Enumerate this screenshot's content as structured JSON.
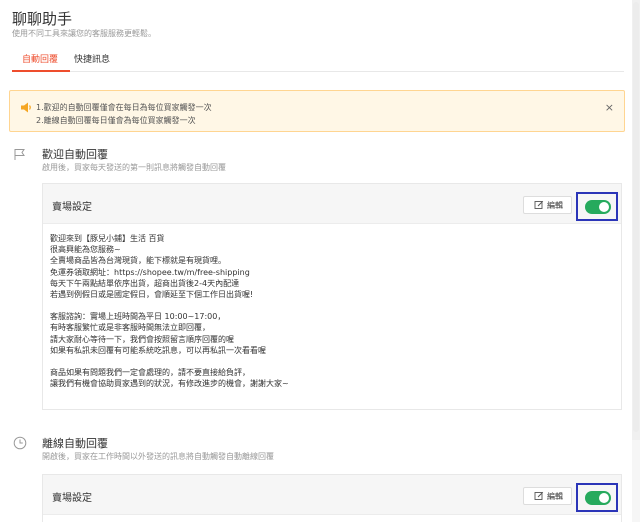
{
  "header": {
    "title": "聊聊助手",
    "subtitle": "使用不同工具來讓您的客服服務更輕鬆。"
  },
  "tabs": [
    {
      "label": "自動回覆",
      "active": true
    },
    {
      "label": "快捷訊息",
      "active": false
    }
  ],
  "notice": {
    "lines": [
      "1.歡迎的自動回覆僅會在每日為每位買家觸發一次",
      "2.離線自動回覆每日僅會為每位買家觸發一次"
    ],
    "close_icon": "×"
  },
  "welcome": {
    "title": "歡迎自動回覆",
    "description": "啟用後，買家每天發送的第一則訊息將觸發自動回覆",
    "card": {
      "title": "賣場設定",
      "edit_label": "編輯",
      "enabled": true,
      "message_lines": [
        "歡迎來到【豚兒小鋪】生活 百貨",
        "很高興能為您服務~",
        "全賣場商品皆為台灣現貨，能下標就是有現貨哩。",
        "免運券領取網址：https://shopee.tw/m/free-shipping",
        "每天下午兩點結單依序出貨，超商出貨後2-4天內配達",
        "若遇到例假日或是國定假日，會順延至下個工作日出貨喔!",
        "",
        "客服諮詢：實場上班時間為平日 10:00~17:00，",
        "有時客服繁忙或是非客服時間無法立即回覆，",
        "請大家耐心等待一下，我們會按照留言順序回覆的喔",
        "如果有私訊未回覆有可能系統吃訊息，可以再私訊一次看看喔",
        "",
        "商品如果有問題我們一定會處理的，請不要直接給負評，",
        "讓我們有機會協助買家遇到的狀況，有修改進步的機會，謝謝大家~"
      ]
    }
  },
  "offline": {
    "title": "離線自動回覆",
    "description": "開啟後，買家在工作時間以外發送的訊息將自動觸發自動離線回覆",
    "card": {
      "title": "賣場設定",
      "edit_label": "編輯",
      "enabled": true
    }
  },
  "colors": {
    "accent": "#ee4d2d",
    "toggle_on": "#26aa5d",
    "highlight_box": "#2b35b8",
    "notice_bg": "#fff7e6",
    "notice_border": "#ffd591"
  }
}
